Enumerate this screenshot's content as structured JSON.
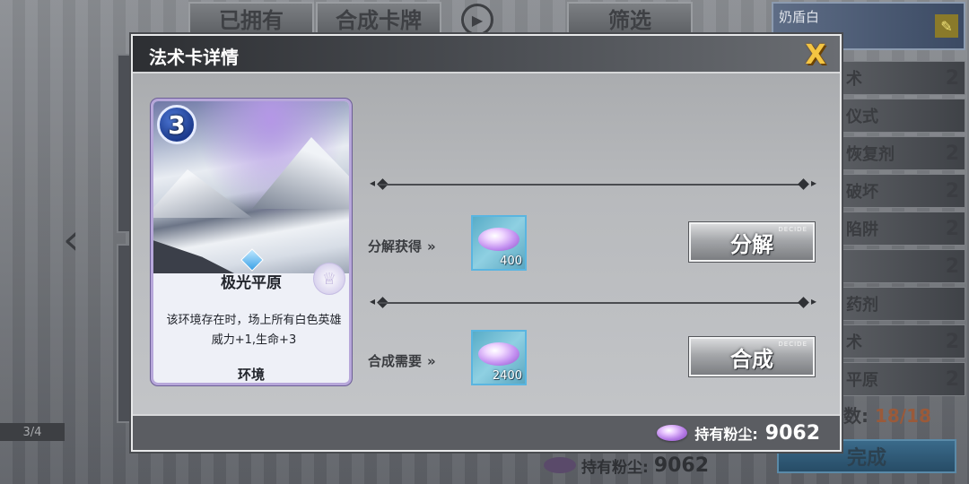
{
  "background": {
    "top_buttons": {
      "owned": "已拥有",
      "craft": "合成卡牌",
      "filter": "筛选",
      "choose_tag": "CHOOSE"
    },
    "page_indicator": "3/4",
    "dust_label": "持有粉尘:",
    "dust_value": "9062"
  },
  "deck": {
    "name": "奶盾白",
    "rows": [
      {
        "label": "术",
        "count": "2"
      },
      {
        "label": "仪式",
        "count": ""
      },
      {
        "label": "恢复剂",
        "count": "2"
      },
      {
        "label": "破坏",
        "count": "2"
      },
      {
        "label": "陷阱",
        "count": "2"
      },
      {
        "label": "",
        "count": "2"
      },
      {
        "label": "药剂",
        "count": ""
      },
      {
        "label": "术",
        "count": "2"
      },
      {
        "label": "平原",
        "count": "2"
      }
    ],
    "count_label": "数:",
    "count_value": "18/18",
    "finish_label": "完成"
  },
  "dialog": {
    "title": "法术卡详情",
    "close_icon": "X",
    "card": {
      "cost": "3",
      "name": "极光平原",
      "description": "该环境存在时，场上所有白色英雄威力+1,生命+3",
      "type": "环境"
    },
    "decompose": {
      "label": "分解获得",
      "arrow": "»",
      "amount": "400",
      "button_label": "分解",
      "button_tag": "DECIDE"
    },
    "craft": {
      "label": "合成需要",
      "arrow": "»",
      "amount": "2400",
      "button_label": "合成",
      "button_tag": "DECIDE"
    },
    "footer": {
      "dust_label": "持有粉尘:",
      "dust_value": "9062"
    }
  },
  "colors": {
    "accent_gold": "#f4c542",
    "dust_purple": "#b57be6",
    "tile_blue": "#5ab5e0"
  }
}
